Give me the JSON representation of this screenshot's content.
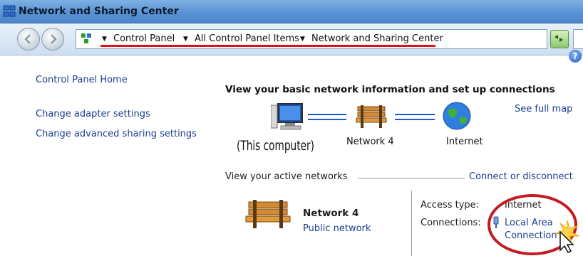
{
  "window": {
    "title": "Network and Sharing Center"
  },
  "address_bar": {
    "breadcrumbs": [
      "Control Panel",
      "All Control Panel Items",
      "Network and Sharing Center"
    ]
  },
  "left_nav": {
    "items": [
      "Control Panel Home",
      "Change adapter settings",
      "Change advanced sharing settings"
    ]
  },
  "main": {
    "heading": "View your basic network information and set up connections",
    "see_full_map": "See full map",
    "map": {
      "computer_label": "(This computer)",
      "network_label": "Network  4",
      "internet_label": "Internet"
    },
    "active_networks": {
      "section_label": "View your active networks",
      "connect_link": "Connect or disconnect",
      "network_name": "Network  4",
      "network_type": "Public network",
      "access_type_label": "Access type:",
      "access_type_value": "Internet",
      "connections_label": "Connections:",
      "connection_line1": "Local Area",
      "connection_line2": "Connection"
    }
  },
  "colors": {
    "link": "#1b3e8f",
    "annotation_red": "#e0101a",
    "titlebar": "#5a93d3"
  }
}
